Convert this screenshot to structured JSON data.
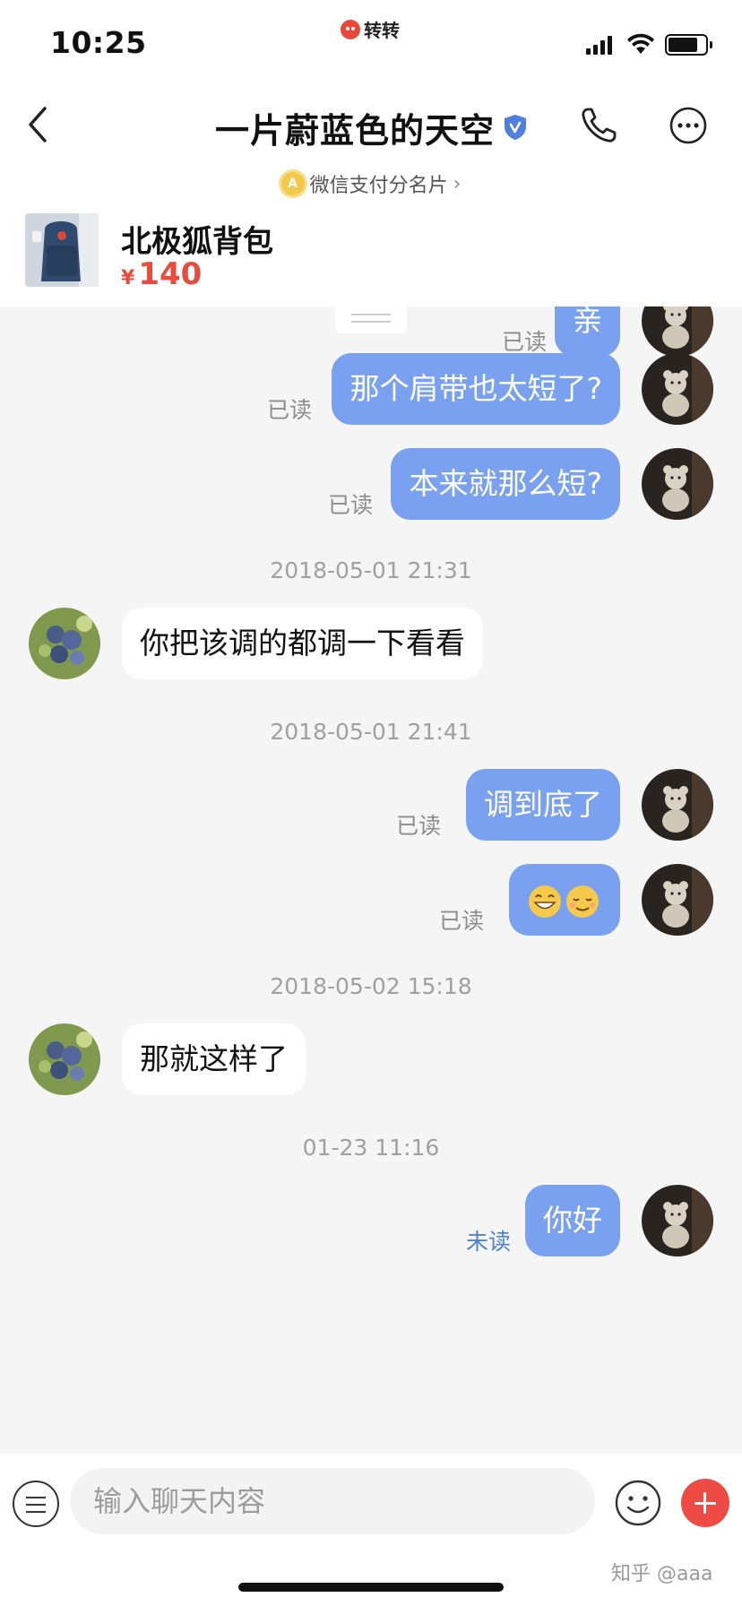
{
  "status_bar": {
    "time": "10:25",
    "carrier_logo_text": "转转"
  },
  "header": {
    "contact_name": "一片蔚蓝色的天空",
    "pay_card_link": "微信支付分名片",
    "pay_badge_letter": "A",
    "icons": [
      "back-arrow-icon",
      "verified-shield-icon",
      "phone-icon",
      "more-icon"
    ]
  },
  "product": {
    "title": "北极狐背包",
    "price_symbol": "¥",
    "price": "140"
  },
  "messages": [
    {
      "sender": "me",
      "text": "亲",
      "status": "已读"
    },
    {
      "sender": "me",
      "text": "那个肩带也太短了?",
      "status": "已读"
    },
    {
      "sender": "me",
      "text": "本来就那么短?",
      "status": "已读"
    },
    {
      "timestamp": "2018-05-01 21:31"
    },
    {
      "sender": "them",
      "text": "你把该调的都调一下看看"
    },
    {
      "timestamp": "2018-05-01 21:41"
    },
    {
      "sender": "me",
      "text": "调到底了",
      "status": "已读"
    },
    {
      "sender": "me",
      "emoji": [
        "grinning-face",
        "relieved-face"
      ],
      "status": "已读"
    },
    {
      "timestamp": "2018-05-02 15:18"
    },
    {
      "sender": "them",
      "text": "那就这样了"
    },
    {
      "timestamp": "01-23 11:16"
    },
    {
      "sender": "me",
      "text": "你好",
      "status": "未读"
    }
  ],
  "input_bar": {
    "placeholder": "输入聊天内容",
    "icons": [
      "menu-icon",
      "emoji-icon",
      "add-icon"
    ]
  },
  "watermark": "知乎 @aaa",
  "colors": {
    "my_bubble": "#7aa1f0",
    "price": "#e94b3c",
    "unread": "#4c82d6",
    "add_button": "#ee4b45"
  }
}
